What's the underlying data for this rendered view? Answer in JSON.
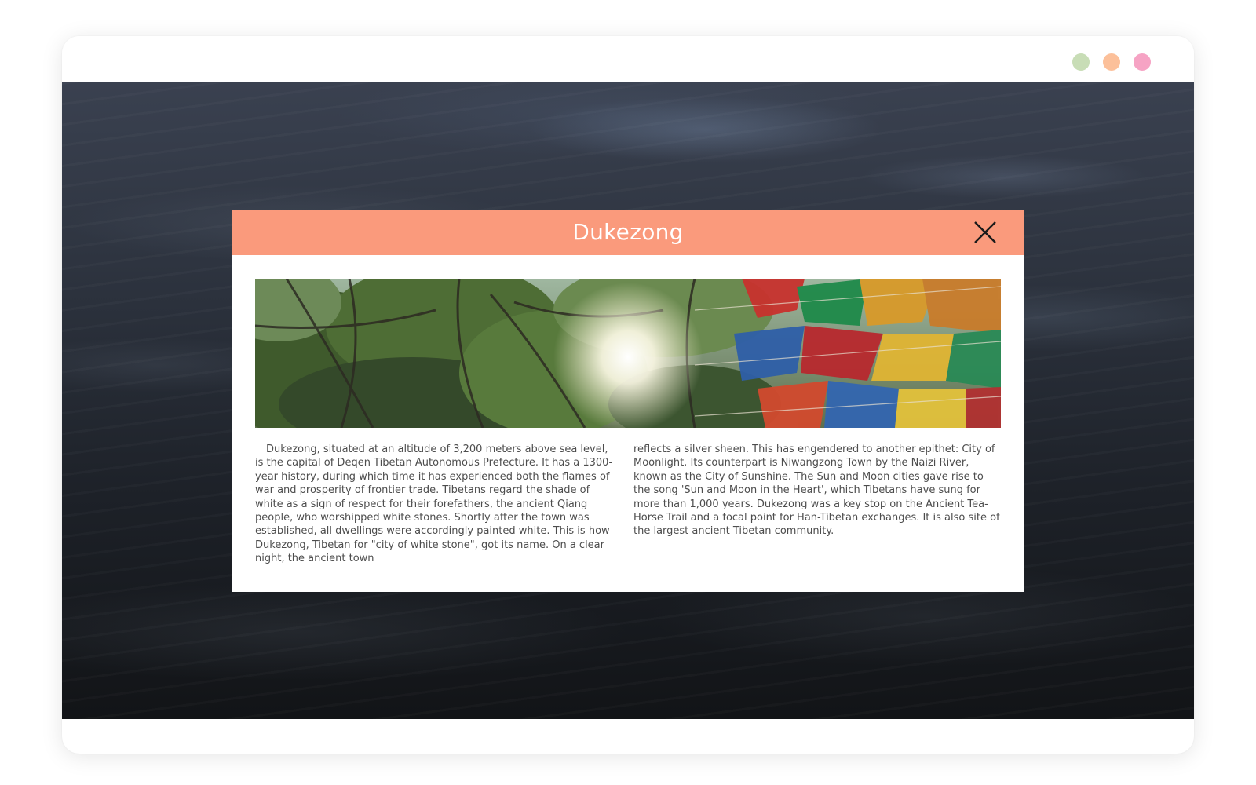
{
  "window": {
    "controls": [
      {
        "name": "green",
        "color": "#c8ddb6"
      },
      {
        "name": "orange",
        "color": "#fcc09a"
      },
      {
        "name": "pink",
        "color": "#f6a3c4"
      }
    ]
  },
  "modal": {
    "title": "Dukezong",
    "header_color": "#fa9a7c",
    "close_icon": "close-icon",
    "banner_icon": "prayer-flags-trees-photo",
    "paragraph_left": "Dukezong, situated at an altitude of 3,200 meters above sea level, is the capital of Deqen Tibetan Autonomous Prefecture. It has a 1300-year history, during which time it has experienced both the flames of war and prosperity of frontier trade. Tibetans regard the shade of white as a sign of respect for their forefathers, the ancient Qiang people, who worshipped white stones. Shortly after the town was established, all dwellings were accordingly painted white. This is how Dukezong, Tibetan for \"city of white stone\", got its name. On a clear night, the ancient town",
    "paragraph_right": "reflects a silver sheen. This has engendered to another epithet: City of Moonlight. Its counterpart is Niwangzong Town by the Naizi River, known as the City of Sunshine. The Sun and Moon cities gave rise to the song 'Sun and Moon in the Heart', which Tibetans have sung for more than 1,000 years. Dukezong was a key stop on the Ancient Tea-Horse Trail and a focal point for Han-Tibetan exchanges. It is also site of the largest ancient Tibetan community."
  }
}
